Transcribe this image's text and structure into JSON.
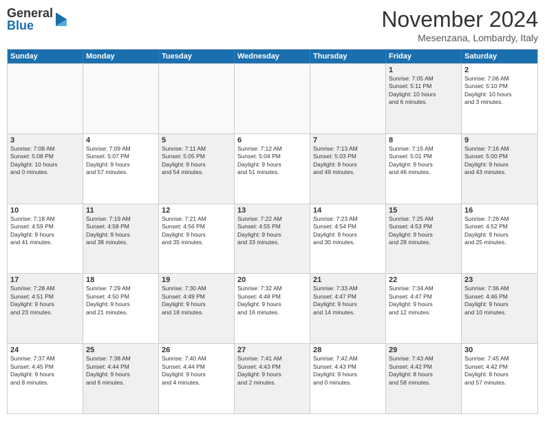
{
  "logo": {
    "general": "General",
    "blue": "Blue"
  },
  "title": "November 2024",
  "location": "Mesenzana, Lombardy, Italy",
  "header_days": [
    "Sunday",
    "Monday",
    "Tuesday",
    "Wednesday",
    "Thursday",
    "Friday",
    "Saturday"
  ],
  "rows": [
    [
      {
        "day": "",
        "info": "",
        "shaded": false,
        "empty": true
      },
      {
        "day": "",
        "info": "",
        "shaded": false,
        "empty": true
      },
      {
        "day": "",
        "info": "",
        "shaded": false,
        "empty": true
      },
      {
        "day": "",
        "info": "",
        "shaded": false,
        "empty": true
      },
      {
        "day": "",
        "info": "",
        "shaded": false,
        "empty": true
      },
      {
        "day": "1",
        "info": "Sunrise: 7:05 AM\nSunset: 5:11 PM\nDaylight: 10 hours\nand 6 minutes.",
        "shaded": true,
        "empty": false
      },
      {
        "day": "2",
        "info": "Sunrise: 7:06 AM\nSunset: 5:10 PM\nDaylight: 10 hours\nand 3 minutes.",
        "shaded": false,
        "empty": false
      }
    ],
    [
      {
        "day": "3",
        "info": "Sunrise: 7:08 AM\nSunset: 5:08 PM\nDaylight: 10 hours\nand 0 minutes.",
        "shaded": true,
        "empty": false
      },
      {
        "day": "4",
        "info": "Sunrise: 7:09 AM\nSunset: 5:07 PM\nDaylight: 9 hours\nand 57 minutes.",
        "shaded": false,
        "empty": false
      },
      {
        "day": "5",
        "info": "Sunrise: 7:11 AM\nSunset: 5:05 PM\nDaylight: 9 hours\nand 54 minutes.",
        "shaded": true,
        "empty": false
      },
      {
        "day": "6",
        "info": "Sunrise: 7:12 AM\nSunset: 5:04 PM\nDaylight: 9 hours\nand 51 minutes.",
        "shaded": false,
        "empty": false
      },
      {
        "day": "7",
        "info": "Sunrise: 7:13 AM\nSunset: 5:03 PM\nDaylight: 9 hours\nand 49 minutes.",
        "shaded": true,
        "empty": false
      },
      {
        "day": "8",
        "info": "Sunrise: 7:15 AM\nSunset: 5:01 PM\nDaylight: 9 hours\nand 46 minutes.",
        "shaded": false,
        "empty": false
      },
      {
        "day": "9",
        "info": "Sunrise: 7:16 AM\nSunset: 5:00 PM\nDaylight: 9 hours\nand 43 minutes.",
        "shaded": true,
        "empty": false
      }
    ],
    [
      {
        "day": "10",
        "info": "Sunrise: 7:18 AM\nSunset: 4:59 PM\nDaylight: 9 hours\nand 41 minutes.",
        "shaded": false,
        "empty": false
      },
      {
        "day": "11",
        "info": "Sunrise: 7:19 AM\nSunset: 4:58 PM\nDaylight: 9 hours\nand 38 minutes.",
        "shaded": true,
        "empty": false
      },
      {
        "day": "12",
        "info": "Sunrise: 7:21 AM\nSunset: 4:56 PM\nDaylight: 9 hours\nand 35 minutes.",
        "shaded": false,
        "empty": false
      },
      {
        "day": "13",
        "info": "Sunrise: 7:22 AM\nSunset: 4:55 PM\nDaylight: 9 hours\nand 33 minutes.",
        "shaded": true,
        "empty": false
      },
      {
        "day": "14",
        "info": "Sunrise: 7:23 AM\nSunset: 4:54 PM\nDaylight: 9 hours\nand 30 minutes.",
        "shaded": false,
        "empty": false
      },
      {
        "day": "15",
        "info": "Sunrise: 7:25 AM\nSunset: 4:53 PM\nDaylight: 9 hours\nand 28 minutes.",
        "shaded": true,
        "empty": false
      },
      {
        "day": "16",
        "info": "Sunrise: 7:26 AM\nSunset: 4:52 PM\nDaylight: 9 hours\nand 25 minutes.",
        "shaded": false,
        "empty": false
      }
    ],
    [
      {
        "day": "17",
        "info": "Sunrise: 7:28 AM\nSunset: 4:51 PM\nDaylight: 9 hours\nand 23 minutes.",
        "shaded": true,
        "empty": false
      },
      {
        "day": "18",
        "info": "Sunrise: 7:29 AM\nSunset: 4:50 PM\nDaylight: 9 hours\nand 21 minutes.",
        "shaded": false,
        "empty": false
      },
      {
        "day": "19",
        "info": "Sunrise: 7:30 AM\nSunset: 4:49 PM\nDaylight: 9 hours\nand 18 minutes.",
        "shaded": true,
        "empty": false
      },
      {
        "day": "20",
        "info": "Sunrise: 7:32 AM\nSunset: 4:48 PM\nDaylight: 9 hours\nand 16 minutes.",
        "shaded": false,
        "empty": false
      },
      {
        "day": "21",
        "info": "Sunrise: 7:33 AM\nSunset: 4:47 PM\nDaylight: 9 hours\nand 14 minutes.",
        "shaded": true,
        "empty": false
      },
      {
        "day": "22",
        "info": "Sunrise: 7:34 AM\nSunset: 4:47 PM\nDaylight: 9 hours\nand 12 minutes.",
        "shaded": false,
        "empty": false
      },
      {
        "day": "23",
        "info": "Sunrise: 7:36 AM\nSunset: 4:46 PM\nDaylight: 9 hours\nand 10 minutes.",
        "shaded": true,
        "empty": false
      }
    ],
    [
      {
        "day": "24",
        "info": "Sunrise: 7:37 AM\nSunset: 4:45 PM\nDaylight: 9 hours\nand 8 minutes.",
        "shaded": false,
        "empty": false
      },
      {
        "day": "25",
        "info": "Sunrise: 7:38 AM\nSunset: 4:44 PM\nDaylight: 9 hours\nand 6 minutes.",
        "shaded": true,
        "empty": false
      },
      {
        "day": "26",
        "info": "Sunrise: 7:40 AM\nSunset: 4:44 PM\nDaylight: 9 hours\nand 4 minutes.",
        "shaded": false,
        "empty": false
      },
      {
        "day": "27",
        "info": "Sunrise: 7:41 AM\nSunset: 4:43 PM\nDaylight: 9 hours\nand 2 minutes.",
        "shaded": true,
        "empty": false
      },
      {
        "day": "28",
        "info": "Sunrise: 7:42 AM\nSunset: 4:43 PM\nDaylight: 9 hours\nand 0 minutes.",
        "shaded": false,
        "empty": false
      },
      {
        "day": "29",
        "info": "Sunrise: 7:43 AM\nSunset: 4:42 PM\nDaylight: 8 hours\nand 58 minutes.",
        "shaded": true,
        "empty": false
      },
      {
        "day": "30",
        "info": "Sunrise: 7:45 AM\nSunset: 4:42 PM\nDaylight: 8 hours\nand 57 minutes.",
        "shaded": false,
        "empty": false
      }
    ]
  ]
}
